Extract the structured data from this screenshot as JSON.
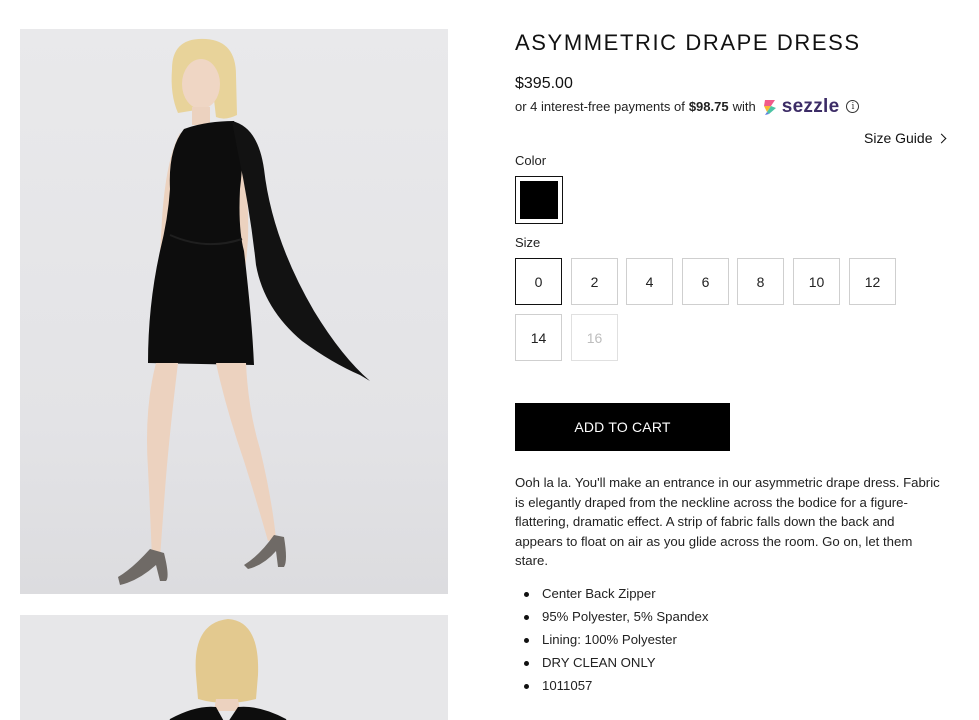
{
  "product": {
    "title": "ASYMMETRIC DRAPE DRESS",
    "price": "$395.00",
    "installment_prefix": "or 4 interest-free payments of",
    "installment_amount": "$98.75",
    "installment_with": "with",
    "payment_provider": "sezzle",
    "info_icon": "ⓘ"
  },
  "size_guide": {
    "label": "Size Guide"
  },
  "color": {
    "label": "Color",
    "selected_swatch_hex": "#000000"
  },
  "size": {
    "label": "Size",
    "options": [
      {
        "label": "0",
        "state": "selected"
      },
      {
        "label": "2",
        "state": "available"
      },
      {
        "label": "4",
        "state": "available"
      },
      {
        "label": "6",
        "state": "available"
      },
      {
        "label": "8",
        "state": "available"
      },
      {
        "label": "10",
        "state": "available"
      },
      {
        "label": "12",
        "state": "available"
      },
      {
        "label": "14",
        "state": "available"
      },
      {
        "label": "16",
        "state": "unavailable"
      }
    ]
  },
  "cart": {
    "add_label": "ADD TO CART"
  },
  "description": "Ooh la la. You'll make an entrance in our asymmetric drape dress. Fabric is elegantly draped from the neckline across the bodice for a figure-flattering, dramatic effect. A strip of fabric falls down the back and appears to float on air as you glide across the room. Go on, let them stare.",
  "features": [
    "Center Back Zipper",
    "95% Polyester, 5% Spandex",
    "Lining: 100% Polyester",
    "DRY CLEAN ONLY",
    "1011057"
  ],
  "colors": {
    "accent": "#000000",
    "sezzle_brand": "#3c2c66"
  }
}
